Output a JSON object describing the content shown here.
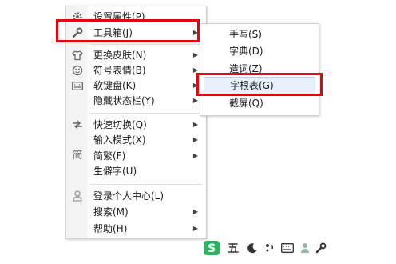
{
  "main_menu": {
    "items": [
      {
        "label": "设置属性(P)",
        "icon": "gear-icon",
        "submenu": false
      },
      {
        "label": "工具箱(J)",
        "icon": "wrench-icon",
        "submenu": true
      },
      {
        "label": "更换皮肤(N)",
        "icon": "shirt-icon",
        "submenu": true
      },
      {
        "label": "符号表情(B)",
        "icon": "smiley-icon",
        "submenu": true
      },
      {
        "label": "软键盘(K)",
        "icon": "keyboard-icon",
        "submenu": true
      },
      {
        "label": "隐藏状态栏(Y)",
        "icon": "",
        "submenu": true
      },
      {
        "label": "快速切换(Q)",
        "icon": "switch-arrows-icon",
        "submenu": true
      },
      {
        "label": "输入模式(X)",
        "icon": "",
        "submenu": true
      },
      {
        "label": "简繁(F)",
        "icon": "jian-character-icon",
        "submenu": true
      },
      {
        "label": "生僻字(U)",
        "icon": "",
        "submenu": false
      },
      {
        "label": "登录个人中心(L)",
        "icon": "user-icon",
        "submenu": false
      },
      {
        "label": "搜索(M)",
        "icon": "",
        "submenu": true
      },
      {
        "label": "帮助(H)",
        "icon": "",
        "submenu": true
      }
    ],
    "jian_glyph": "简"
  },
  "sub_menu": {
    "items": [
      {
        "label": "手写(S)"
      },
      {
        "label": "字典(D)"
      },
      {
        "label": "造词(Z)"
      },
      {
        "label": "字根表(G)",
        "highlighted": true
      },
      {
        "label": "截屏(Q)"
      }
    ]
  },
  "taskbar": {
    "wu_label": "五",
    "icons": [
      "sogou-s-logo",
      "chinese-mode-wu",
      "moon-icon",
      "punctuation-icon",
      "keyboard-icon",
      "user-icon",
      "wrench-icon"
    ]
  },
  "colors": {
    "highlight_box": "#e8000f",
    "sogou_green": "#2db35d"
  }
}
